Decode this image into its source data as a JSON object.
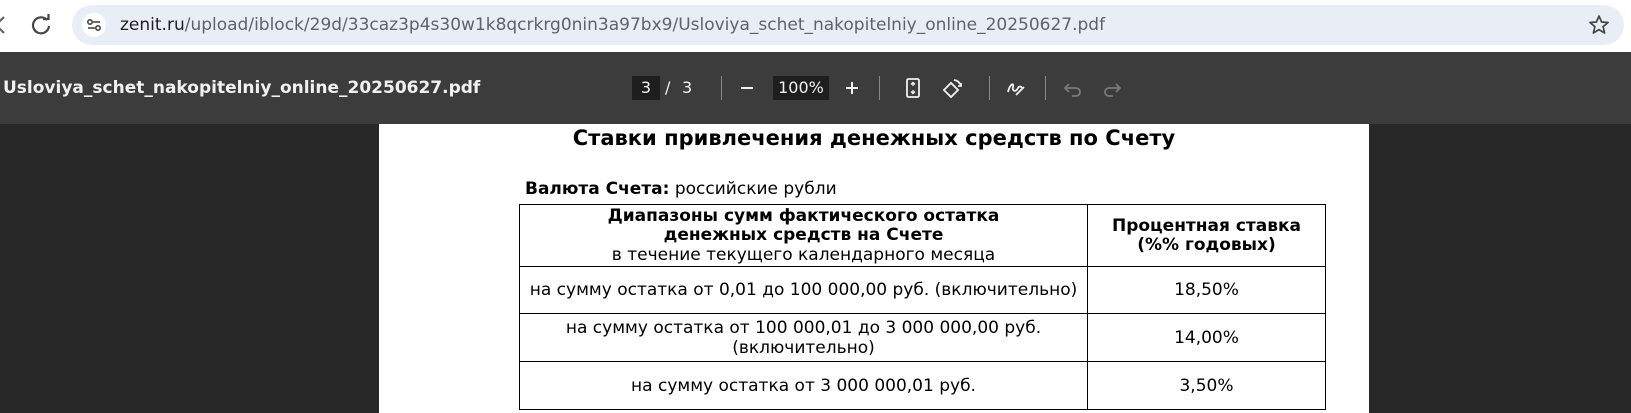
{
  "browser": {
    "url_domain": "zenit.ru",
    "url_path": "/upload/iblock/29d/33caz3p4s30w1k8qcrkrg0nin3a97bx9/Usloviya_schet_nakopitelniy_online_20250627.pdf"
  },
  "pdf_toolbar": {
    "title": "Usloviya_schet_nakopitelniy_online_20250627.pdf",
    "current_page": "3",
    "page_separator": "/",
    "total_pages": "3",
    "zoom": "100%"
  },
  "document": {
    "heading": "Ставки привлечения денежных средств по Счету",
    "currency_label": "Валюта Счета:",
    "currency_value": "российские рубли",
    "table": {
      "header_col1_line1": "Диапазоны сумм фактического остатка",
      "header_col1_line2": "денежных средств на Счете",
      "header_col1_line3": "в течение текущего календарного месяца",
      "header_col2_line1": "Процентная ставка",
      "header_col2_line2": "(%% годовых)",
      "rows": [
        {
          "range": "на сумму остатка от 0,01 до 100 000,00 руб. (включительно)",
          "rate": "18,50%"
        },
        {
          "range_line1": "на сумму остатка от 100 000,01 до 3 000 000,00 руб.",
          "range_line2": "(включительно)",
          "rate": "14,00%"
        },
        {
          "range": "на сумму остатка от 3 000 000,01 руб.",
          "rate": "3,50%"
        }
      ]
    }
  },
  "icons": {
    "back": "back-arrow-icon",
    "reload": "reload-icon",
    "site_info": "site-info-icon",
    "bookmark": "star-icon",
    "zoom_out": "minus-icon",
    "zoom_in": "plus-icon",
    "fit": "fit-page-icon",
    "rotate": "rotate-icon",
    "annotate": "draw-icon",
    "undo": "undo-icon",
    "redo": "redo-icon"
  }
}
